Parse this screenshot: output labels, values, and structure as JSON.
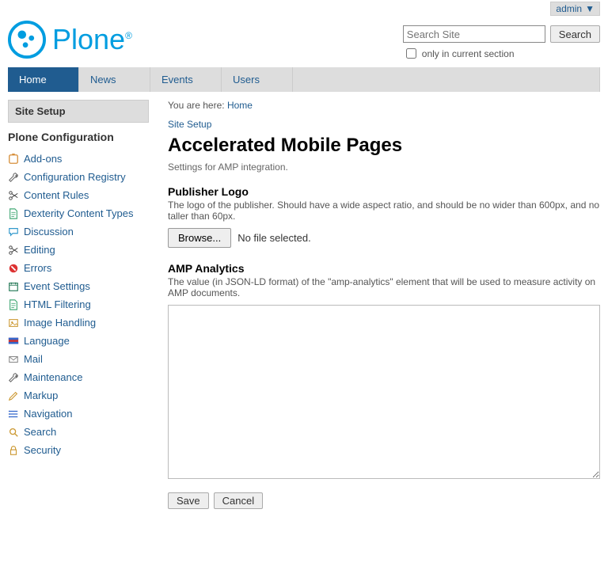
{
  "user": {
    "name": "admin",
    "dropdown_glyph": "▼"
  },
  "logo": {
    "word": "Plone",
    "reg": "®"
  },
  "search": {
    "placeholder": "Search Site",
    "button": "Search",
    "only_label": "only in current section"
  },
  "tabs": [
    {
      "label": "Home",
      "active": true
    },
    {
      "label": "News",
      "active": false
    },
    {
      "label": "Events",
      "active": false
    },
    {
      "label": "Users",
      "active": false
    }
  ],
  "sidebar": {
    "portlet_title": "Site Setup",
    "section_title": "Plone Configuration",
    "items": [
      {
        "label": "Add-ons",
        "icon": "puzzle"
      },
      {
        "label": "Configuration Registry",
        "icon": "wrench"
      },
      {
        "label": "Content Rules",
        "icon": "scissors"
      },
      {
        "label": "Dexterity Content Types",
        "icon": "doc"
      },
      {
        "label": "Discussion",
        "icon": "comment"
      },
      {
        "label": "Editing",
        "icon": "scissors"
      },
      {
        "label": "Errors",
        "icon": "error"
      },
      {
        "label": "Event Settings",
        "icon": "calendar"
      },
      {
        "label": "HTML Filtering",
        "icon": "doc"
      },
      {
        "label": "Image Handling",
        "icon": "image"
      },
      {
        "label": "Language",
        "icon": "flag"
      },
      {
        "label": "Mail",
        "icon": "mail"
      },
      {
        "label": "Maintenance",
        "icon": "wrench"
      },
      {
        "label": "Markup",
        "icon": "pencil"
      },
      {
        "label": "Navigation",
        "icon": "nav"
      },
      {
        "label": "Search",
        "icon": "search"
      },
      {
        "label": "Security",
        "icon": "lock"
      }
    ]
  },
  "breadcrumbs": {
    "prefix": "You are here:",
    "home": "Home"
  },
  "main": {
    "back_link": "Site Setup",
    "title": "Accelerated Mobile Pages",
    "subtitle": "Settings for AMP integration.",
    "publisher_logo": {
      "label": "Publisher Logo",
      "help": "The logo of the publisher. Should have a wide aspect ratio, and should be no wider than 600px, and no taller than 60px.",
      "browse": "Browse...",
      "status": "No file selected."
    },
    "amp_analytics": {
      "label": "AMP Analytics",
      "help": "The value (in JSON-LD format) of the \"amp-analytics\" element that will be used to measure activity on AMP documents.",
      "value": ""
    },
    "actions": {
      "save": "Save",
      "cancel": "Cancel"
    }
  }
}
